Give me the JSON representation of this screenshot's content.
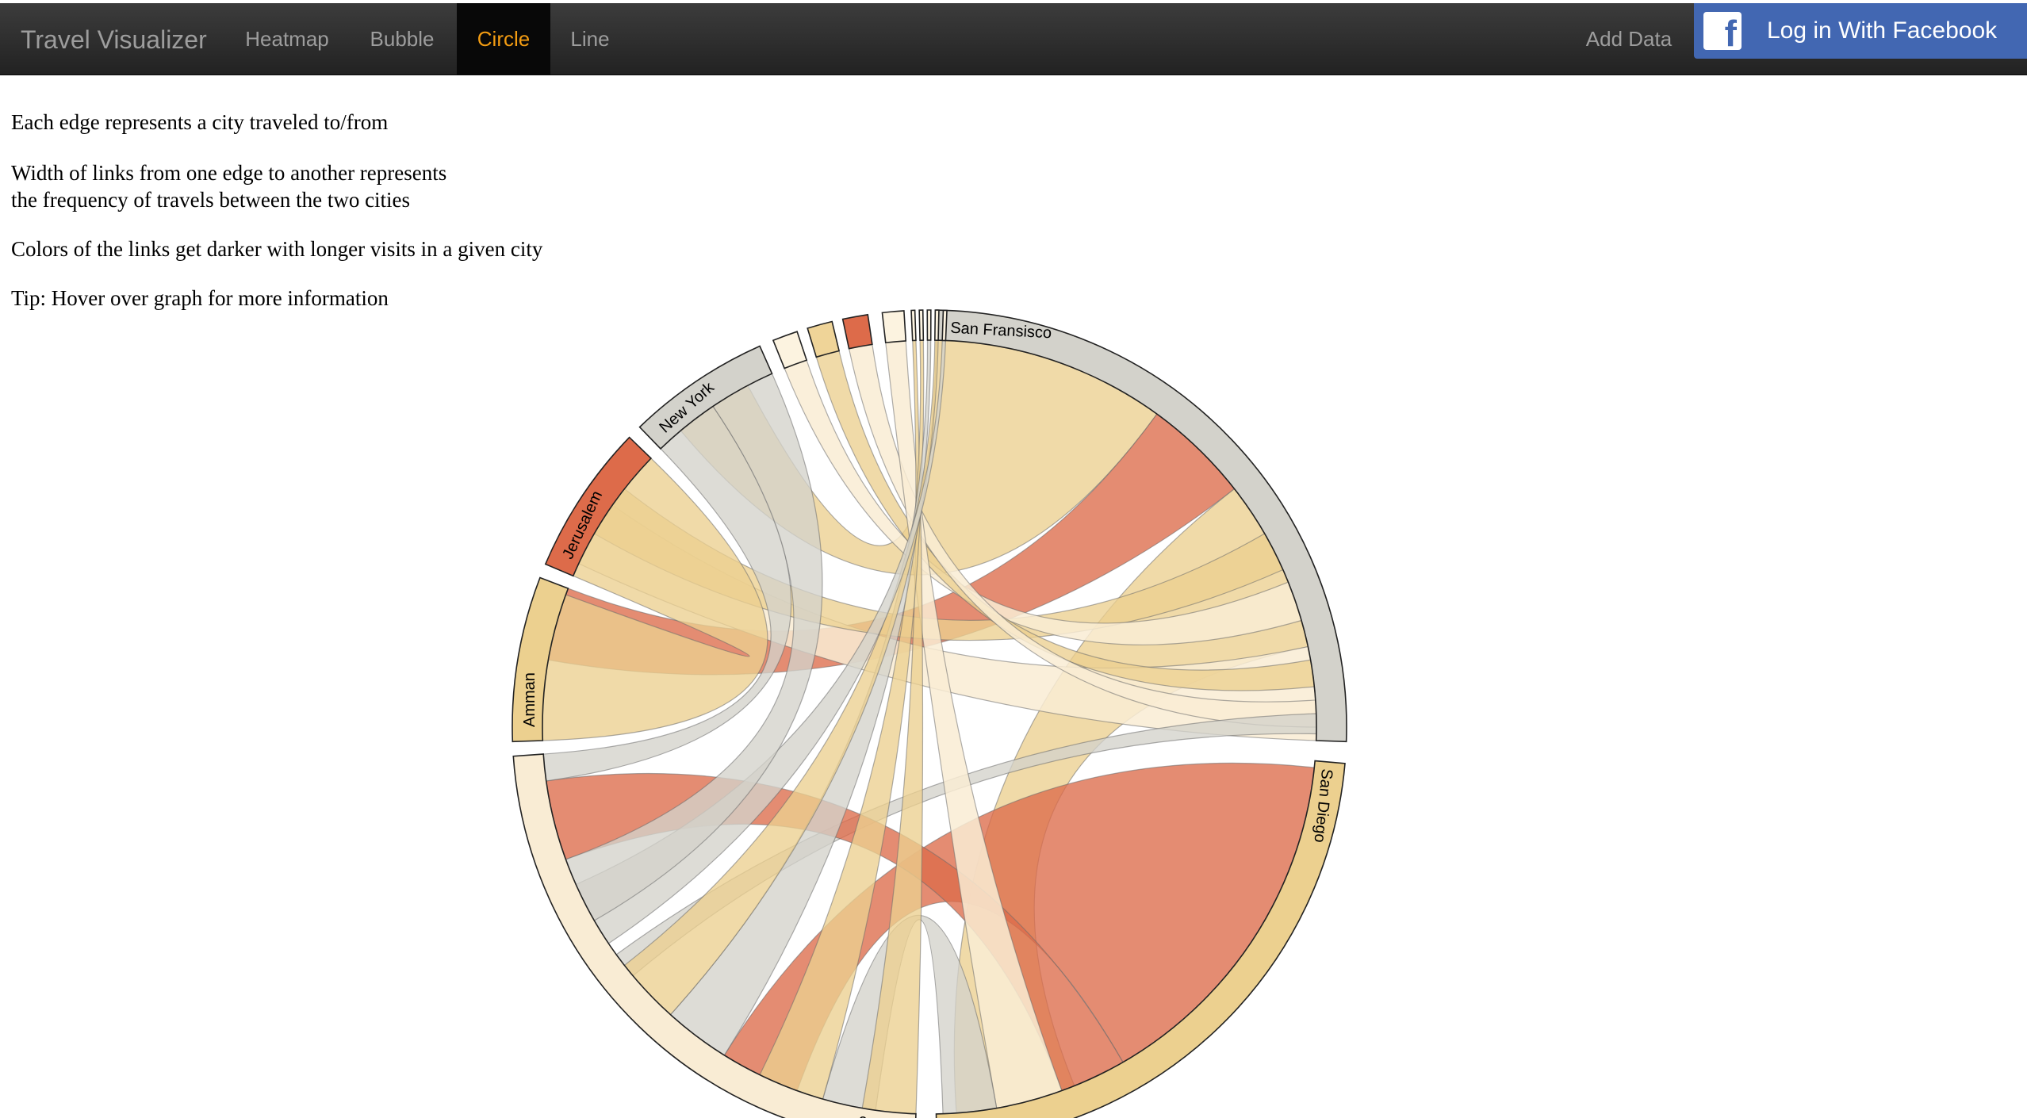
{
  "navbar": {
    "brand": "Travel Visualizer",
    "items": [
      {
        "label": "Heatmap",
        "active": false
      },
      {
        "label": "Bubble",
        "active": false
      },
      {
        "label": "Circle",
        "active": true
      },
      {
        "label": "Line",
        "active": false
      }
    ],
    "add_data": "Add Data",
    "facebook_login": "Log in With Facebook"
  },
  "description": {
    "line1": "Each edge represents a city traveled to/from",
    "line2a": "Width of links from one edge to another represents",
    "line2b": "the frequency of travels between the two cities",
    "line3": "Colors of the links get darker with longer visits in a given city",
    "tip": "Tip: Hover over graph for more information"
  },
  "chart_data": {
    "type": "chord",
    "groups": [
      {
        "name": "San Fransisco",
        "color": "#d3d2cb"
      },
      {
        "name": "San Diego",
        "color": "#ecd08f"
      },
      {
        "name": "Los Angeles",
        "color": "#f9ecd4"
      },
      {
        "name": "Amman",
        "color": "#ecd08f"
      },
      {
        "name": "Jerusalem",
        "color": "#dd6b4a"
      },
      {
        "name": "New York",
        "color": "#d3d2cb"
      },
      {
        "name": "",
        "color": "#fcf3e0"
      },
      {
        "name": "",
        "color": "#efd498"
      },
      {
        "name": "",
        "color": "#dd6b4a"
      },
      {
        "name": "",
        "color": "#fcf3e0"
      },
      {
        "name": "",
        "color": "#fcf3e0"
      },
      {
        "name": "",
        "color": "#fcf3e0"
      },
      {
        "name": "",
        "color": "#fcf3e0"
      },
      {
        "name": "",
        "color": "#fcf3e0"
      },
      {
        "name": "",
        "color": "#fcf3e0"
      }
    ],
    "ribbon_colors": {
      "light": "#f9ecd4",
      "tan": "#ecd08f",
      "grey": "#d3d2cb",
      "red": "#dd6b4a"
    }
  }
}
